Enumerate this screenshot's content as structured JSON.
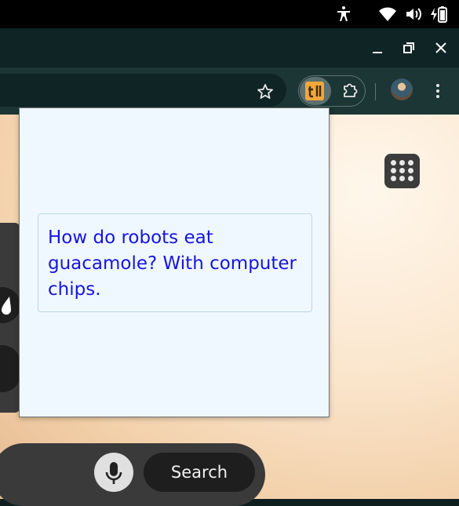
{
  "status_bar": {
    "icons": [
      "accessibility-icon",
      "wifi-icon",
      "volume-icon",
      "battery-charging-icon"
    ]
  },
  "window_controls": {
    "icons": [
      "minimize-icon",
      "restore-icon",
      "close-icon"
    ]
  },
  "toolbar": {
    "icons": [
      "bookmark-star-icon",
      "extension-tl-icon",
      "extensions-puzzle-icon",
      "profile-avatar",
      "more-menu-icon"
    ],
    "extension_label": "tl"
  },
  "popup": {
    "joke": "How do robots eat guacamole? With computer chips."
  },
  "page": {
    "search_button_label": "Search",
    "icons": [
      "apps-grid-icon",
      "mic-icon"
    ]
  },
  "colors": {
    "popup_bg": "#f0f8ff",
    "joke_text": "#1515e0",
    "extension_accent": "#f2a63b",
    "toolbar_bg": "#1c3535"
  }
}
